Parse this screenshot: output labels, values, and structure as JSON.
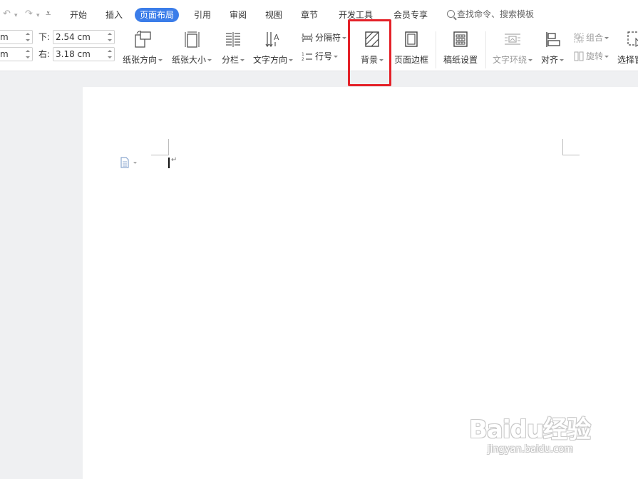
{
  "menu": {
    "tabs": [
      {
        "label": "开始"
      },
      {
        "label": "插入"
      },
      {
        "label": "页面布局"
      },
      {
        "label": "引用"
      },
      {
        "label": "审阅"
      },
      {
        "label": "视图"
      },
      {
        "label": "章节"
      },
      {
        "label": "开发工具"
      },
      {
        "label": "会员专享"
      }
    ],
    "active_tab": "页面布局",
    "search_placeholder": "查找命令、搜索模板"
  },
  "margins": {
    "top_fragment_unit": "m",
    "bottom_fragment_unit": "m",
    "lower_label": "下:",
    "lower_value": "2.54 cm",
    "right_label": "右:",
    "right_value": "3.18 cm"
  },
  "ribbon": {
    "orientation": "纸张方向",
    "size": "纸张大小",
    "columns": "分栏",
    "text_direction": "文字方向",
    "breaks": "分隔符",
    "line_numbers": "行号",
    "background": "背景",
    "page_border": "页面边框",
    "manuscript": "稿纸设置",
    "text_wrap": "文字环绕",
    "align": "对齐",
    "group": "组合",
    "rotate": "旋转",
    "select_pane": "选择窗"
  },
  "colors": {
    "accent": "#3b7de9",
    "highlight_box": "#e42128"
  },
  "watermark": {
    "brand": "Baidu经验",
    "url": "jingyan.baidu.com"
  }
}
